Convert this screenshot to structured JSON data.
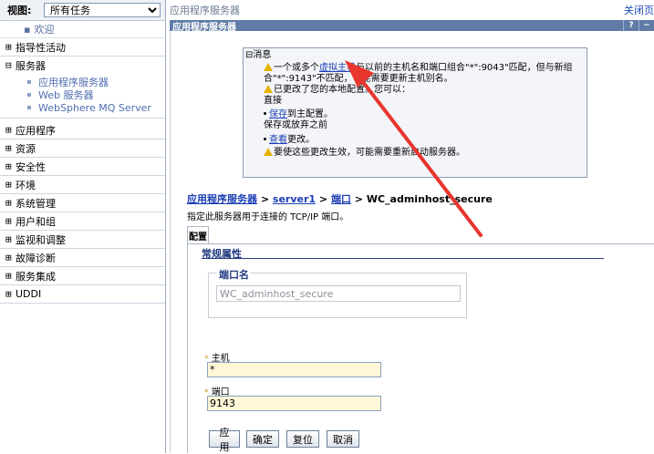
{
  "nav": {
    "view_label": "视图:",
    "view_select": "所有任务",
    "welcome": "欢迎",
    "sections": [
      {
        "key": "guided",
        "toggle": "⊞",
        "label": "指导性活动"
      },
      {
        "key": "servers",
        "toggle": "⊟",
        "label": "服务器"
      },
      {
        "key": "apps",
        "toggle": "⊞",
        "label": "应用程序"
      },
      {
        "key": "resources",
        "toggle": "⊞",
        "label": "资源"
      },
      {
        "key": "security",
        "toggle": "⊞",
        "label": "安全性"
      },
      {
        "key": "environment",
        "toggle": "⊞",
        "label": "环境"
      },
      {
        "key": "sysadmin",
        "toggle": "⊞",
        "label": "系统管理"
      },
      {
        "key": "users",
        "toggle": "⊞",
        "label": "用户和组"
      },
      {
        "key": "monitoring",
        "toggle": "⊞",
        "label": "监视和调整"
      },
      {
        "key": "troubleshooting",
        "toggle": "⊞",
        "label": "故障诊断"
      },
      {
        "key": "integration",
        "toggle": "⊞",
        "label": "服务集成"
      },
      {
        "key": "uddi",
        "toggle": "⊞",
        "label": "UDDI"
      }
    ],
    "server_items": [
      "应用程序服务器",
      "Web 服务器",
      "WebSphere MQ Server"
    ]
  },
  "main": {
    "top_title": "应用程序服务器",
    "close_link": "关闭页",
    "panel_title": "应用程序服务器",
    "help_icon": "?",
    "minimize_icon": "−",
    "messages": {
      "header_toggle": "⊟",
      "header": "消息",
      "line1_pre": "一个或多个",
      "line1_link": "虚拟主机",
      "line1_post": "与以前的主机名和端口组合\"*\":9043\"匹配，但与新组",
      "line1_cont": "合\"*\":9143\"不匹配，可能需要更新主机别名。",
      "line2": "已更改了您的本地配置。您可以：",
      "line3": "直接",
      "save_link": "保存",
      "save_post": "到主配置。",
      "line4": "保存或放弃之前",
      "review_link": "查看",
      "review_post": "更改。",
      "line5": "要使这些更改生效，可能需要重新启动服务器。"
    },
    "breadcrumb": {
      "c1": "应用程序服务器",
      "sep": " > ",
      "c2": "server1",
      "c3": "端口",
      "c4": "WC_adminhost_secure"
    },
    "description": "指定此服务器用于连接的 TCP/IP 端口。",
    "tab_label": "配置",
    "general_props": "常规属性",
    "port_name_legend": "端口名",
    "port_name_value": "WC_adminhost_secure",
    "host_label": "主机",
    "host_value": "*",
    "port_label": "端口",
    "port_value": "9143",
    "required_mark": "*",
    "buttons": {
      "apply": "应用",
      "ok": "确定",
      "reset": "复位",
      "cancel": "取消"
    }
  },
  "colors": {
    "title_bar": "#5f7ba6",
    "link": "#1c3fb5",
    "warning": "#e5b400",
    "annotation_arrow": "#e8352e",
    "input_bg": "#fff7d8"
  },
  "icons": {
    "warning": "warning-triangle-icon",
    "arrow": "red-annotation-arrow"
  }
}
